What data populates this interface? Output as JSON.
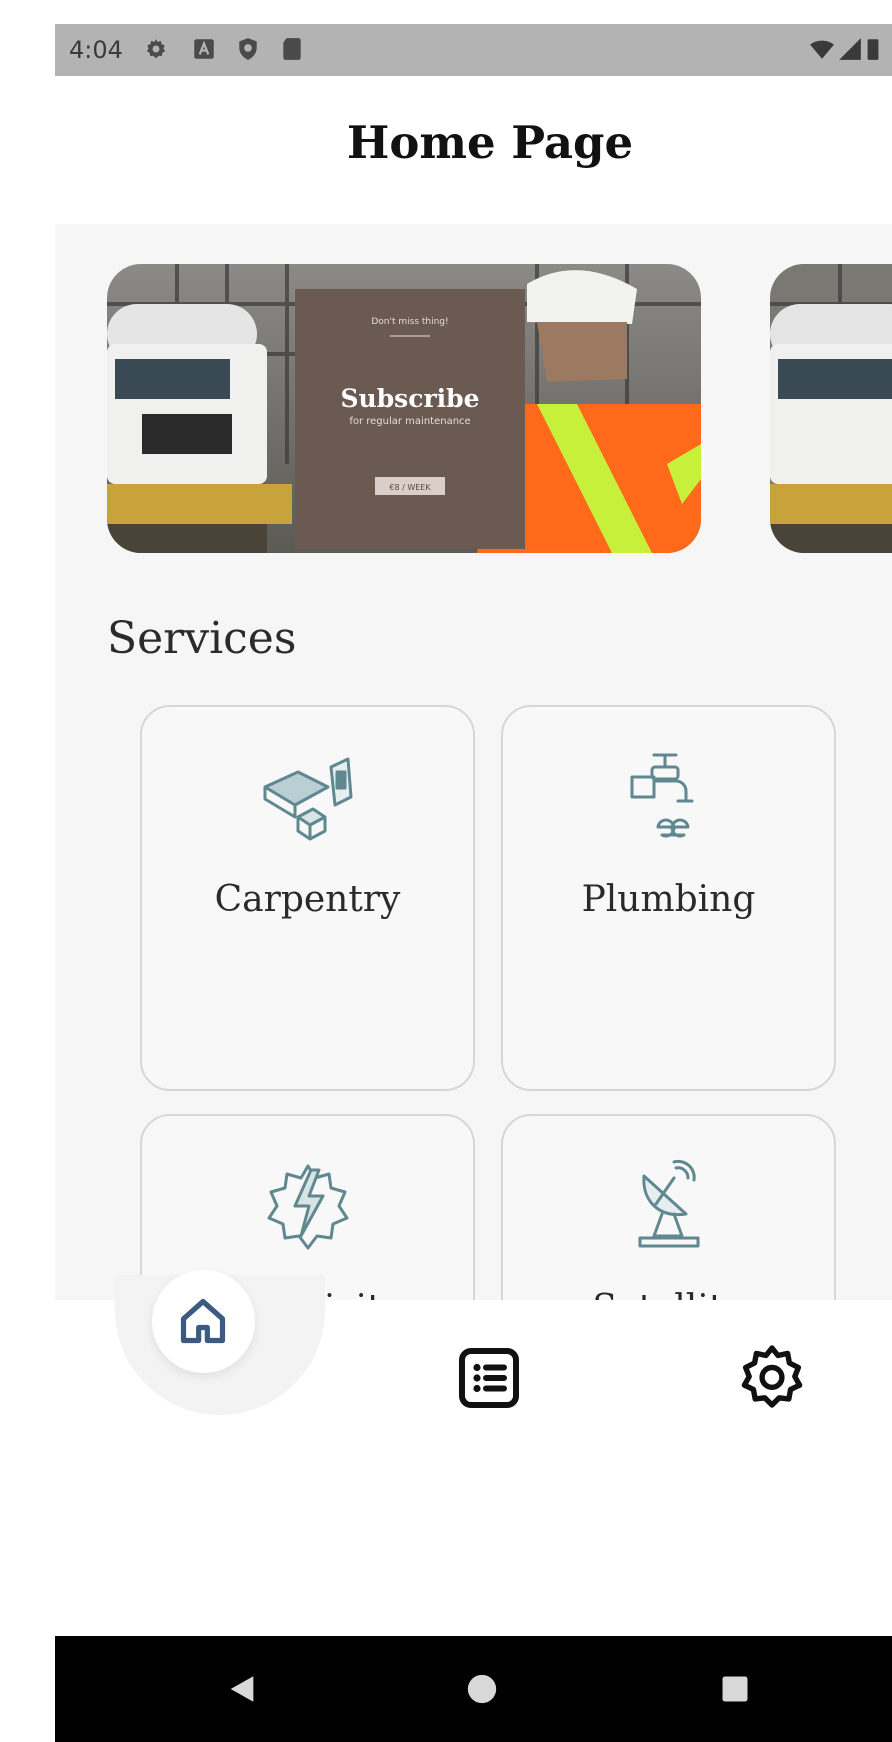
{
  "status_bar": {
    "time": "4:04",
    "icons": [
      "gear-icon",
      "a-box-icon",
      "shield-icon",
      "sdcard-icon",
      "wifi-icon",
      "signal-icon",
      "battery-icon"
    ]
  },
  "app_bar": {
    "title": "Home Page"
  },
  "banner": {
    "headline": "Subscribe",
    "tagline": "Don't miss thing!",
    "subtext": "for regular maintenance",
    "tag": "€8 / WEEK"
  },
  "services": {
    "title": "Services",
    "items": [
      {
        "label": "Carpentry",
        "icon": "carpentry-icon"
      },
      {
        "label": "Plumbing",
        "icon": "plumbing-icon"
      },
      {
        "label": "Electricity",
        "icon": "electricity-icon"
      },
      {
        "label": "Satellite",
        "icon": "satellite-icon"
      }
    ]
  },
  "bottom_nav": {
    "items": [
      "home-icon",
      "list-icon",
      "settings-icon"
    ],
    "active": "home-icon",
    "active_color": "#3d5a80"
  },
  "system_nav": [
    "back-icon",
    "home-circle-icon",
    "recents-icon"
  ]
}
